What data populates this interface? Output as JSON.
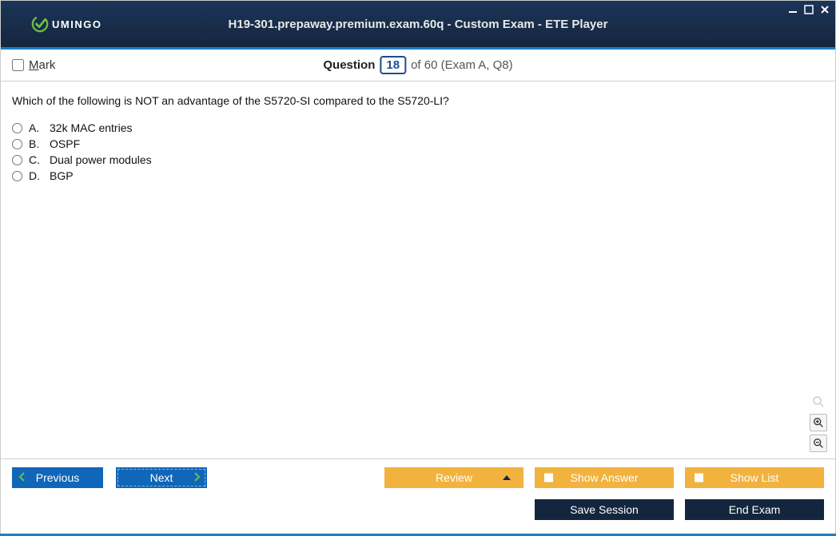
{
  "brand": {
    "name": "UMINGO"
  },
  "title": "H19-301.prepaway.premium.exam.60q - Custom Exam - ETE Player",
  "header": {
    "mark_label": "Mark",
    "question_word": "Question",
    "current": "18",
    "of_text": "of 60 (Exam A, Q8)"
  },
  "question": {
    "text": "Which of the following is NOT an advantage of the S5720-SI compared to the S5720-LI?",
    "options": [
      {
        "letter": "A.",
        "text": "32k MAC entries"
      },
      {
        "letter": "B.",
        "text": "OSPF"
      },
      {
        "letter": "C.",
        "text": "Dual power modules"
      },
      {
        "letter": "D.",
        "text": "BGP"
      }
    ]
  },
  "buttons": {
    "previous": "Previous",
    "next": "Next",
    "review": "Review",
    "show_answer": "Show Answer",
    "show_list": "Show List",
    "save_session": "Save Session",
    "end_exam": "End Exam"
  }
}
